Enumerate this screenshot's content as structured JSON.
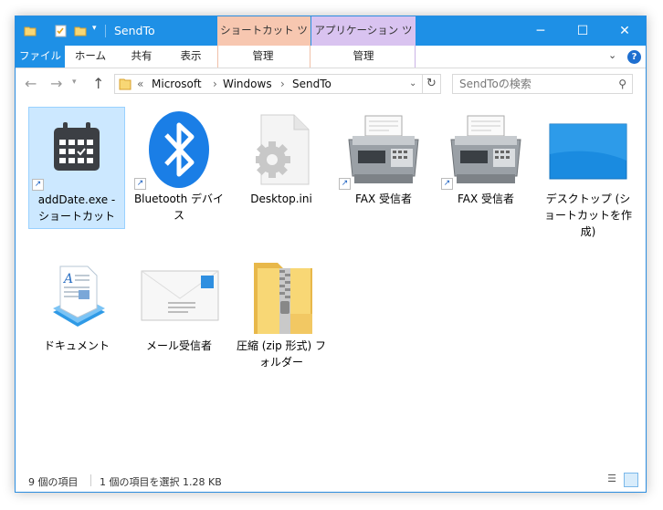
{
  "window": {
    "title": "SendTo",
    "context_tab_shortcut": "ショートカット ツール",
    "context_tab_app": "アプリケーション ツール",
    "colors": {
      "titlebar": "#1e90e6",
      "shortcut_tab": "#f7c7b0",
      "app_tab": "#d9c3f0"
    }
  },
  "ribbon": {
    "tabs": [
      "ファイル",
      "ホーム",
      "共有",
      "表示",
      "管理",
      "管理"
    ]
  },
  "nav": {
    "path": [
      "Microsoft",
      "Windows",
      "SendTo"
    ],
    "overflow": "«",
    "search_placeholder": "SendToの検索"
  },
  "items": [
    {
      "label": "addDate.exe - ショートカット",
      "icon": "calendar-shortcut-icon",
      "selected": true
    },
    {
      "label": "Bluetooth デバイス",
      "icon": "bluetooth-icon"
    },
    {
      "label": "Desktop.ini",
      "icon": "settings-file-icon"
    },
    {
      "label": "FAX 受信者",
      "icon": "fax-icon"
    },
    {
      "label": "FAX 受信者",
      "icon": "fax-icon"
    },
    {
      "label": "デスクトップ (ショートカットを作成)",
      "icon": "desktop-icon"
    },
    {
      "label": "ドキュメント",
      "icon": "document-icon"
    },
    {
      "label": "メール受信者",
      "icon": "mail-icon"
    },
    {
      "label": "圧縮 (zip 形式) フォルダー",
      "icon": "zip-folder-icon"
    }
  ],
  "status": {
    "count": "9 個の項目",
    "selection": "1 個の項目を選択  1.28 KB"
  }
}
